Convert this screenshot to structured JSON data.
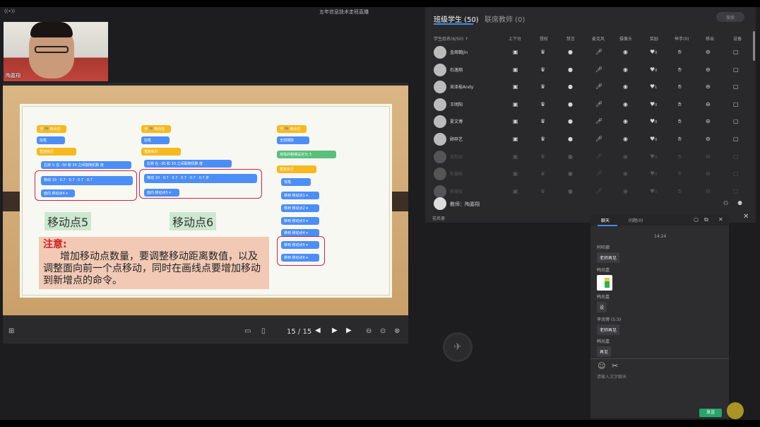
{
  "top": {
    "title": "五年信息技术走班直播",
    "live_label": "((•))"
  },
  "camera": {
    "name": "陶嘉翔"
  },
  "slide": {
    "left_blocks": {
      "hat": "当 🏁 被点击",
      "b1": "抬笔",
      "loop": "重复执行",
      "turn": "右转 ↻ 在 -30 和 30 之间取随机数 度",
      "move": "移动 10 · 0.7 · 0.7 · 0.7 · 0.7",
      "face": "面向 移动点4 ▾"
    },
    "mid_blocks": {
      "hat": "当 🏁 被点击",
      "b1": "抬笔",
      "loop": "重复执行",
      "turn": "右转 在 -30 和 30 之间取随机数 度",
      "move": "移动 10 · 0.7 · 0.7 · 0.7 · 0.7 · 0.7 步",
      "face": "面向 移动点5 ▾"
    },
    "right_blocks": {
      "hat": "当 🏁 被点击",
      "b1": "全部擦除",
      "b2": "将笔的粗细设定为 3",
      "loop": "重复执行",
      "b3": "落笔",
      "moves": [
        "移到 移动点1 ▾",
        "移到 移动点2 ▾",
        "移到 移动点3 ▾",
        "移到 移动点4 ▾",
        "移到 移动点5 ▾",
        "移到 移动点6 ▾"
      ]
    },
    "label5": "移动点5",
    "label6": "移动点6",
    "note_title": "注意:",
    "note_body": "增加移动点数量，要调整移动距离数值，以及调整面向前一个点移动，同时在画线点要增加移动到新增点的命令。"
  },
  "controls": {
    "page": "15 / 15"
  },
  "panel": {
    "tab_students": "班级学生 (50)",
    "tab_teachers": "联席教师 (0)",
    "search_placeholder": "搜索",
    "headers": [
      "学生姓名(6/50) ↑",
      "上下台",
      "授权",
      "禁言",
      "麦克风",
      "摄像头",
      "奖励",
      "举手(0)",
      "移出",
      "设备"
    ],
    "students": [
      {
        "name": "金周翰jin",
        "reward": "0"
      },
      {
        "name": "石逸翔",
        "reward": "0"
      },
      {
        "name": "宋泽裕Andy",
        "reward": "1"
      },
      {
        "name": "王明阳",
        "reward": "0"
      },
      {
        "name": "夏文博",
        "reward": "0"
      },
      {
        "name": "顾梓艺",
        "reward": "0"
      },
      {
        "name": "吴阳泽",
        "reward": "0"
      },
      {
        "name": "陈墨晗",
        "reward": "0"
      },
      {
        "name": "陈墨晗",
        "reward": "0"
      }
    ],
    "teacher": "教师：陶嘉翔",
    "flowers": "花名册"
  },
  "chat": {
    "tab_chat": "聊天",
    "tab_question": "问题(0)",
    "time": "14:24",
    "messages": [
      {
        "name": "阿旺娜",
        "text": "老师再见"
      },
      {
        "name": "韩尚嘉",
        "text": ""
      },
      {
        "name": "韩尚嘉",
        "text": "设"
      },
      {
        "name": "李润博 (5:3)",
        "text": "老师再见"
      },
      {
        "name": "韩尚嘉",
        "text": "再见"
      }
    ],
    "placeholder": "请输入文字聊天",
    "send": "发送"
  },
  "colors": {
    "accent": "#3a8ef2",
    "send": "#27a46a",
    "highlight": "#d0214c"
  }
}
